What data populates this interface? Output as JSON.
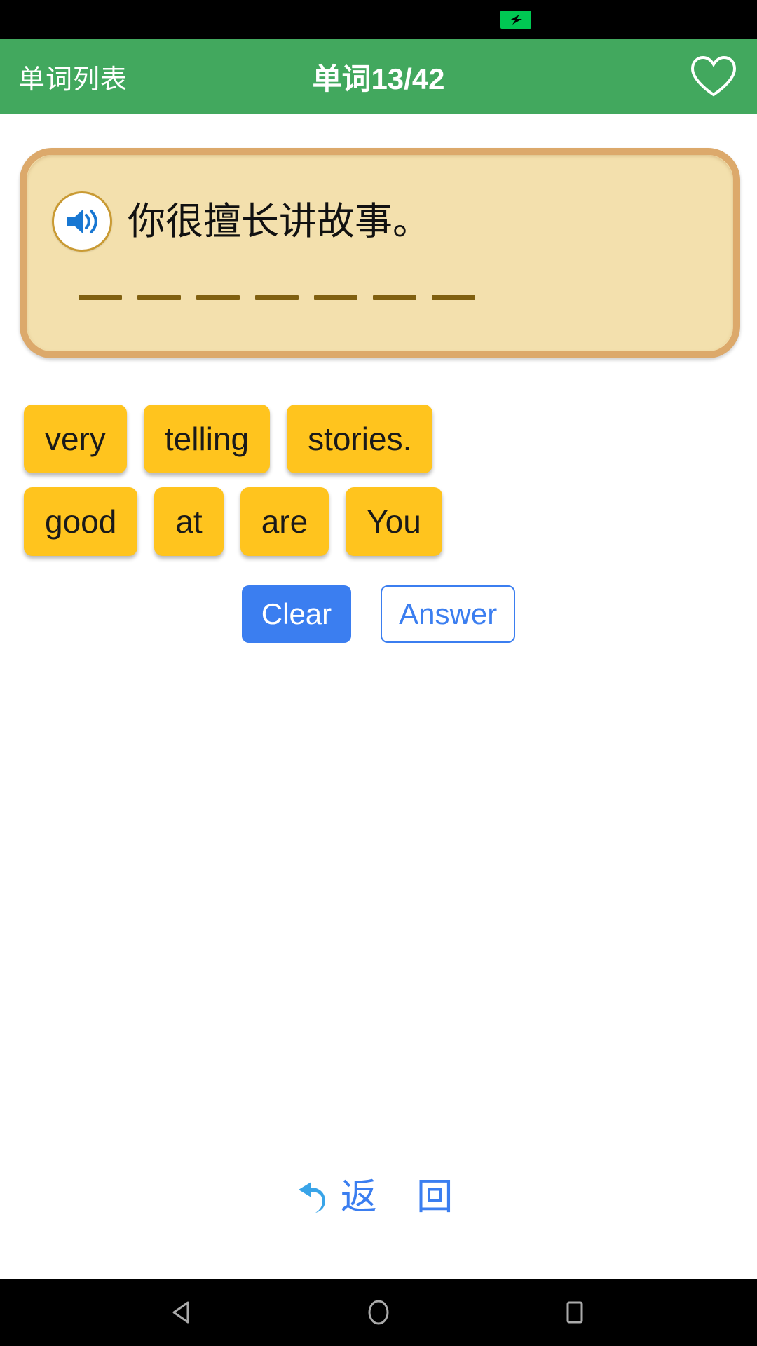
{
  "status_bar": {
    "battery_icon": "battery-charging-icon",
    "battery_color": "#00c853"
  },
  "app_bar": {
    "back_label": "单词列表",
    "title": "单词13/42",
    "favorite_icon": "heart-outline-icon",
    "background_color": "#42a85e",
    "text_color": "#ffffff"
  },
  "card": {
    "speaker_icon": "speaker-volume-icon",
    "sentence": "你很擅长讲故事。",
    "blank_count": 7,
    "background_color": "#f3e0ad",
    "border_color": "#dca96b",
    "dash_color": "#806010"
  },
  "tiles": {
    "color": "#ffc41e",
    "rows": [
      [
        "very",
        "telling",
        "stories."
      ],
      [
        "good",
        "at",
        "are",
        "You"
      ]
    ]
  },
  "actions": {
    "clear_label": "Clear",
    "answer_label": "Answer",
    "accent_color": "#3b7ef0"
  },
  "return_link": {
    "icon": "undo-arrow-icon",
    "label": "返 回",
    "color": "#3b7ef0"
  },
  "nav_bar": {
    "back_icon": "triangle-back-icon",
    "home_icon": "circle-home-icon",
    "recents_icon": "square-recents-icon"
  }
}
